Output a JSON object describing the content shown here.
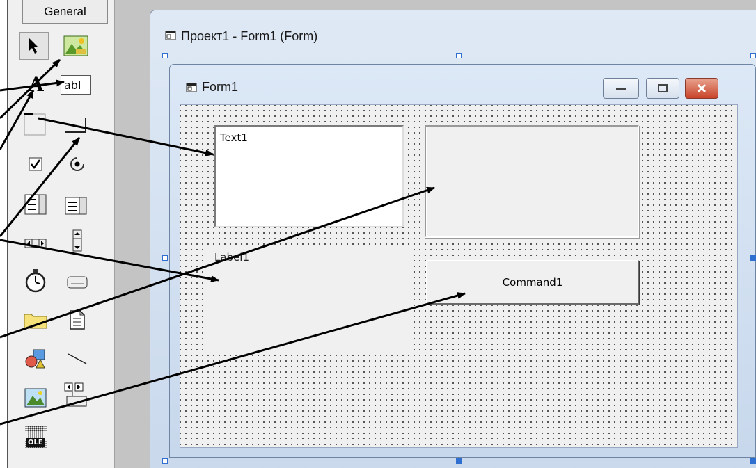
{
  "toolbox": {
    "tab_label": "General",
    "textbox_icon_text": "abl",
    "ole_icon_text": "OLE",
    "tools": [
      "pointer-icon",
      "picturebox-icon",
      "label-icon",
      "textbox-icon",
      "frame-icon",
      "command-button-icon",
      "checkbox-icon",
      "option-button-icon",
      "combobox-icon",
      "listbox-icon",
      "hscrollbar-icon",
      "vscrollbar-icon",
      "timer-icon",
      "drive-listbox-icon",
      "dir-listbox-icon",
      "file-listbox-icon",
      "shape-icon",
      "line-icon",
      "image-icon",
      "data-icon",
      "ole-icon"
    ]
  },
  "designer": {
    "title": "Проект1 - Form1 (Form)"
  },
  "form": {
    "title": "Form1"
  },
  "controls": {
    "text1": "Text1",
    "label1": "Label1",
    "command1": "Command1"
  },
  "colors": {
    "close_button": "#c9442a",
    "selection_handle": "#2f6fd0",
    "workspace": "#c4c4c4"
  }
}
